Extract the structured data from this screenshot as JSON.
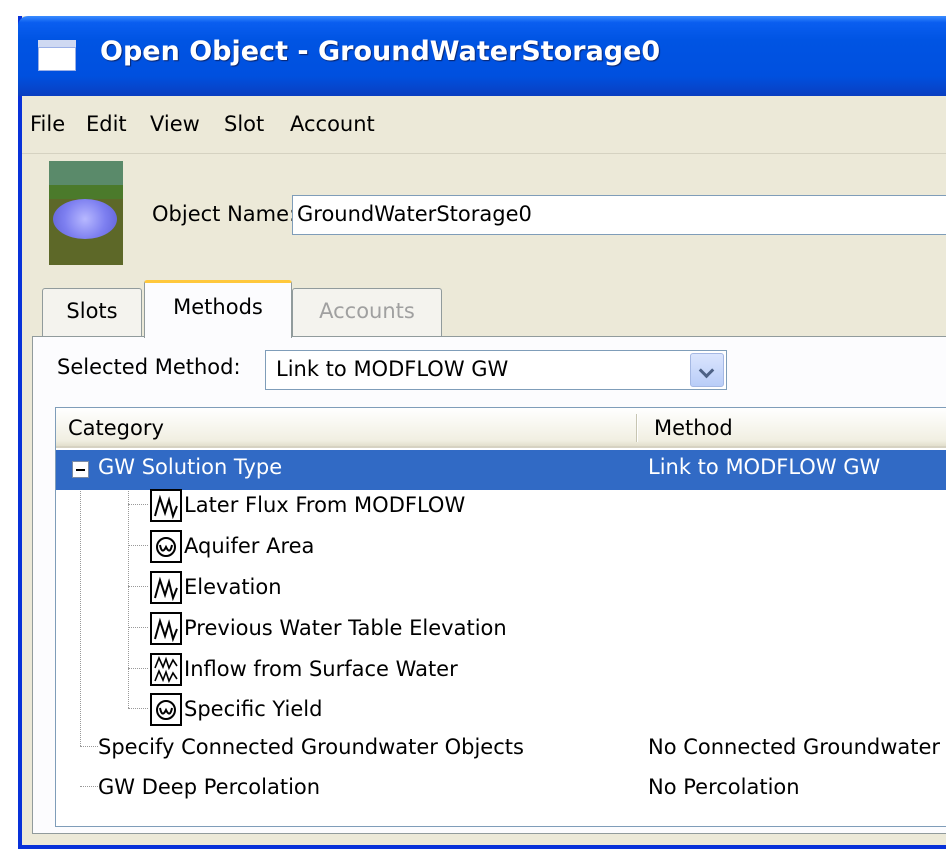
{
  "window": {
    "title": "Open Object - GroundWaterStorage0"
  },
  "menu": [
    "File",
    "Edit",
    "View",
    "Slot",
    "Account"
  ],
  "object": {
    "name_label": "Object Name:",
    "name_value": "GroundWaterStorage0"
  },
  "tabs": [
    {
      "label": "Slots",
      "state": "normal"
    },
    {
      "label": "Methods",
      "state": "active"
    },
    {
      "label": "Accounts",
      "state": "disabled"
    }
  ],
  "selector": {
    "label": "Selected Method:",
    "value": "Link to MODFLOW GW"
  },
  "tree": {
    "columns": {
      "category": "Category",
      "method": "Method"
    },
    "root": {
      "category": "GW Solution Type",
      "method": "Link to MODFLOW GW"
    },
    "children": [
      {
        "label": "Later Flux From MODFLOW",
        "icon": "series-icon"
      },
      {
        "label": "Aquifer Area",
        "icon": "scalar-icon"
      },
      {
        "label": "Elevation",
        "icon": "series-icon"
      },
      {
        "label": "Previous Water Table Elevation",
        "icon": "series-icon"
      },
      {
        "label": "Inflow from Surface Water",
        "icon": "multi-series-icon"
      },
      {
        "label": "Specific Yield",
        "icon": "scalar-icon"
      }
    ],
    "rows": [
      {
        "category": "Specify Connected Groundwater Objects",
        "method": "No Connected Groundwater"
      },
      {
        "category": "GW Deep Percolation",
        "method": "No Percolation"
      }
    ]
  }
}
